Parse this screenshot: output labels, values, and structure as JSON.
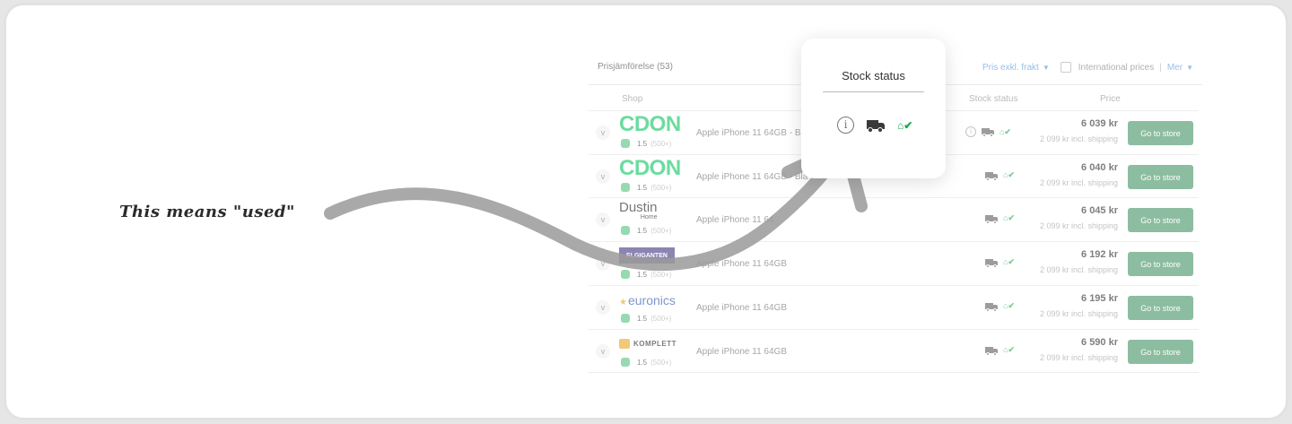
{
  "table": {
    "title": "Prisjämförelse (53)",
    "price_toggle": "Pris exkl. frakt",
    "international": "International prices",
    "separator": "|",
    "more": "Mer",
    "col_shop": "Shop",
    "col_stock": "Stock status",
    "col_price": "Price",
    "rows": [
      {
        "shop": "CDON",
        "rating": "1.5",
        "count": "(500+)",
        "product": "Apple iPhone 11 64GB - B",
        "price": "6 039 kr",
        "shipping": "2 099 kr incl. shipping",
        "button": "Go to store"
      },
      {
        "shop": "CDON",
        "rating": "1.5",
        "count": "(500+)",
        "product": "Apple iPhone 11 64GB - Bla",
        "price": "6 040 kr",
        "shipping": "2 099 kr incl. shipping",
        "button": "Go to store"
      },
      {
        "shop": "Dustin",
        "shop_sub": "Home",
        "rating": "1.5",
        "count": "(500+)",
        "product": "Apple iPhone 11 64",
        "price": "6 045 kr",
        "shipping": "2 099 kr incl. shipping",
        "button": "Go to store"
      },
      {
        "shop": "ELGIGANTEN",
        "rating": "1.5",
        "count": "(500+)",
        "product": "Apple iPhone 11 64GB",
        "price": "6 192 kr",
        "shipping": "2 099 kr incl. shipping",
        "button": "Go to store"
      },
      {
        "shop": "euronics",
        "rating": "1.5",
        "count": "(500+)",
        "product": "Apple iPhone 11 64GB",
        "price": "6 195 kr",
        "shipping": "2 099 kr incl. shipping",
        "button": "Go to store"
      },
      {
        "shop": "KOMPLETT",
        "rating": "1.5",
        "count": "(500+)",
        "product": "Apple iPhone 11 64GB",
        "price": "6 590 kr",
        "shipping": "2 099 kr incl. shipping",
        "button": "Go to store"
      }
    ]
  },
  "popup": {
    "title": "Stock status",
    "icons": [
      "info-icon",
      "truck-icon",
      "store-check-icon"
    ]
  },
  "annotation": {
    "text": "This means \"used\""
  },
  "colors": {
    "button": "#3b8f5c",
    "link": "#4a8fd6",
    "in_stock": "#1ba84b",
    "cdon": "#00c45a"
  }
}
